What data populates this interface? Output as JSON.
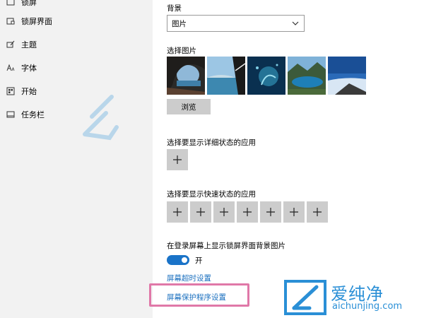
{
  "sidebar": {
    "items": [
      {
        "label": "锁屏",
        "icon": "image-icon"
      },
      {
        "label": "锁屏界面",
        "icon": "lockscreen-icon"
      },
      {
        "label": "主题",
        "icon": "theme-icon"
      },
      {
        "label": "字体",
        "icon": "font-icon"
      },
      {
        "label": "开始",
        "icon": "start-icon"
      },
      {
        "label": "任务栏",
        "icon": "taskbar-icon"
      }
    ]
  },
  "main": {
    "background_label": "背景",
    "background_value": "图片",
    "choose_picture_label": "选择图片",
    "browse_label": "浏览",
    "detailed_status_label": "选择要显示详细状态的应用",
    "quick_status_label": "选择要显示快速状态的应用",
    "show_bg_label": "在登录屏幕上显示锁屏界面背景图片",
    "toggle_state": "开",
    "toggle_on": true,
    "screen_timeout_link": "屏幕超时设置",
    "screensaver_link": "屏幕保护程序设置",
    "plus_symbol": "+"
  },
  "watermark": {
    "text_main": "爱纯净",
    "text_sub": "aichunjing.com",
    "center_text_main": "爱纯净",
    "center_text_sub": "aichunjing.com"
  },
  "colors": {
    "accent": "#1a73c8",
    "link": "#1a6fbf",
    "highlight_border": "#e078a8",
    "watermark": "#2a8fd6",
    "sidebar_bg": "#f2f2f2",
    "button_bg": "#cccccc"
  }
}
